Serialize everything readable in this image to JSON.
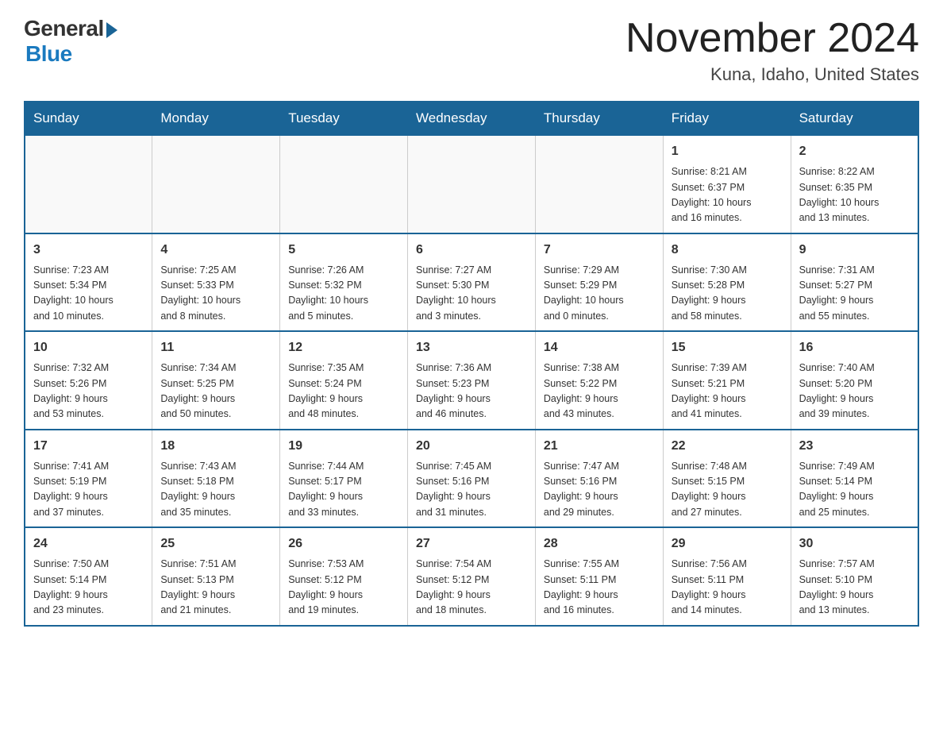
{
  "logo": {
    "general": "General",
    "blue": "Blue"
  },
  "title": "November 2024",
  "subtitle": "Kuna, Idaho, United States",
  "weekdays": [
    "Sunday",
    "Monday",
    "Tuesday",
    "Wednesday",
    "Thursday",
    "Friday",
    "Saturday"
  ],
  "weeks": [
    [
      {
        "day": "",
        "info": ""
      },
      {
        "day": "",
        "info": ""
      },
      {
        "day": "",
        "info": ""
      },
      {
        "day": "",
        "info": ""
      },
      {
        "day": "",
        "info": ""
      },
      {
        "day": "1",
        "info": "Sunrise: 8:21 AM\nSunset: 6:37 PM\nDaylight: 10 hours\nand 16 minutes."
      },
      {
        "day": "2",
        "info": "Sunrise: 8:22 AM\nSunset: 6:35 PM\nDaylight: 10 hours\nand 13 minutes."
      }
    ],
    [
      {
        "day": "3",
        "info": "Sunrise: 7:23 AM\nSunset: 5:34 PM\nDaylight: 10 hours\nand 10 minutes."
      },
      {
        "day": "4",
        "info": "Sunrise: 7:25 AM\nSunset: 5:33 PM\nDaylight: 10 hours\nand 8 minutes."
      },
      {
        "day": "5",
        "info": "Sunrise: 7:26 AM\nSunset: 5:32 PM\nDaylight: 10 hours\nand 5 minutes."
      },
      {
        "day": "6",
        "info": "Sunrise: 7:27 AM\nSunset: 5:30 PM\nDaylight: 10 hours\nand 3 minutes."
      },
      {
        "day": "7",
        "info": "Sunrise: 7:29 AM\nSunset: 5:29 PM\nDaylight: 10 hours\nand 0 minutes."
      },
      {
        "day": "8",
        "info": "Sunrise: 7:30 AM\nSunset: 5:28 PM\nDaylight: 9 hours\nand 58 minutes."
      },
      {
        "day": "9",
        "info": "Sunrise: 7:31 AM\nSunset: 5:27 PM\nDaylight: 9 hours\nand 55 minutes."
      }
    ],
    [
      {
        "day": "10",
        "info": "Sunrise: 7:32 AM\nSunset: 5:26 PM\nDaylight: 9 hours\nand 53 minutes."
      },
      {
        "day": "11",
        "info": "Sunrise: 7:34 AM\nSunset: 5:25 PM\nDaylight: 9 hours\nand 50 minutes."
      },
      {
        "day": "12",
        "info": "Sunrise: 7:35 AM\nSunset: 5:24 PM\nDaylight: 9 hours\nand 48 minutes."
      },
      {
        "day": "13",
        "info": "Sunrise: 7:36 AM\nSunset: 5:23 PM\nDaylight: 9 hours\nand 46 minutes."
      },
      {
        "day": "14",
        "info": "Sunrise: 7:38 AM\nSunset: 5:22 PM\nDaylight: 9 hours\nand 43 minutes."
      },
      {
        "day": "15",
        "info": "Sunrise: 7:39 AM\nSunset: 5:21 PM\nDaylight: 9 hours\nand 41 minutes."
      },
      {
        "day": "16",
        "info": "Sunrise: 7:40 AM\nSunset: 5:20 PM\nDaylight: 9 hours\nand 39 minutes."
      }
    ],
    [
      {
        "day": "17",
        "info": "Sunrise: 7:41 AM\nSunset: 5:19 PM\nDaylight: 9 hours\nand 37 minutes."
      },
      {
        "day": "18",
        "info": "Sunrise: 7:43 AM\nSunset: 5:18 PM\nDaylight: 9 hours\nand 35 minutes."
      },
      {
        "day": "19",
        "info": "Sunrise: 7:44 AM\nSunset: 5:17 PM\nDaylight: 9 hours\nand 33 minutes."
      },
      {
        "day": "20",
        "info": "Sunrise: 7:45 AM\nSunset: 5:16 PM\nDaylight: 9 hours\nand 31 minutes."
      },
      {
        "day": "21",
        "info": "Sunrise: 7:47 AM\nSunset: 5:16 PM\nDaylight: 9 hours\nand 29 minutes."
      },
      {
        "day": "22",
        "info": "Sunrise: 7:48 AM\nSunset: 5:15 PM\nDaylight: 9 hours\nand 27 minutes."
      },
      {
        "day": "23",
        "info": "Sunrise: 7:49 AM\nSunset: 5:14 PM\nDaylight: 9 hours\nand 25 minutes."
      }
    ],
    [
      {
        "day": "24",
        "info": "Sunrise: 7:50 AM\nSunset: 5:14 PM\nDaylight: 9 hours\nand 23 minutes."
      },
      {
        "day": "25",
        "info": "Sunrise: 7:51 AM\nSunset: 5:13 PM\nDaylight: 9 hours\nand 21 minutes."
      },
      {
        "day": "26",
        "info": "Sunrise: 7:53 AM\nSunset: 5:12 PM\nDaylight: 9 hours\nand 19 minutes."
      },
      {
        "day": "27",
        "info": "Sunrise: 7:54 AM\nSunset: 5:12 PM\nDaylight: 9 hours\nand 18 minutes."
      },
      {
        "day": "28",
        "info": "Sunrise: 7:55 AM\nSunset: 5:11 PM\nDaylight: 9 hours\nand 16 minutes."
      },
      {
        "day": "29",
        "info": "Sunrise: 7:56 AM\nSunset: 5:11 PM\nDaylight: 9 hours\nand 14 minutes."
      },
      {
        "day": "30",
        "info": "Sunrise: 7:57 AM\nSunset: 5:10 PM\nDaylight: 9 hours\nand 13 minutes."
      }
    ]
  ]
}
